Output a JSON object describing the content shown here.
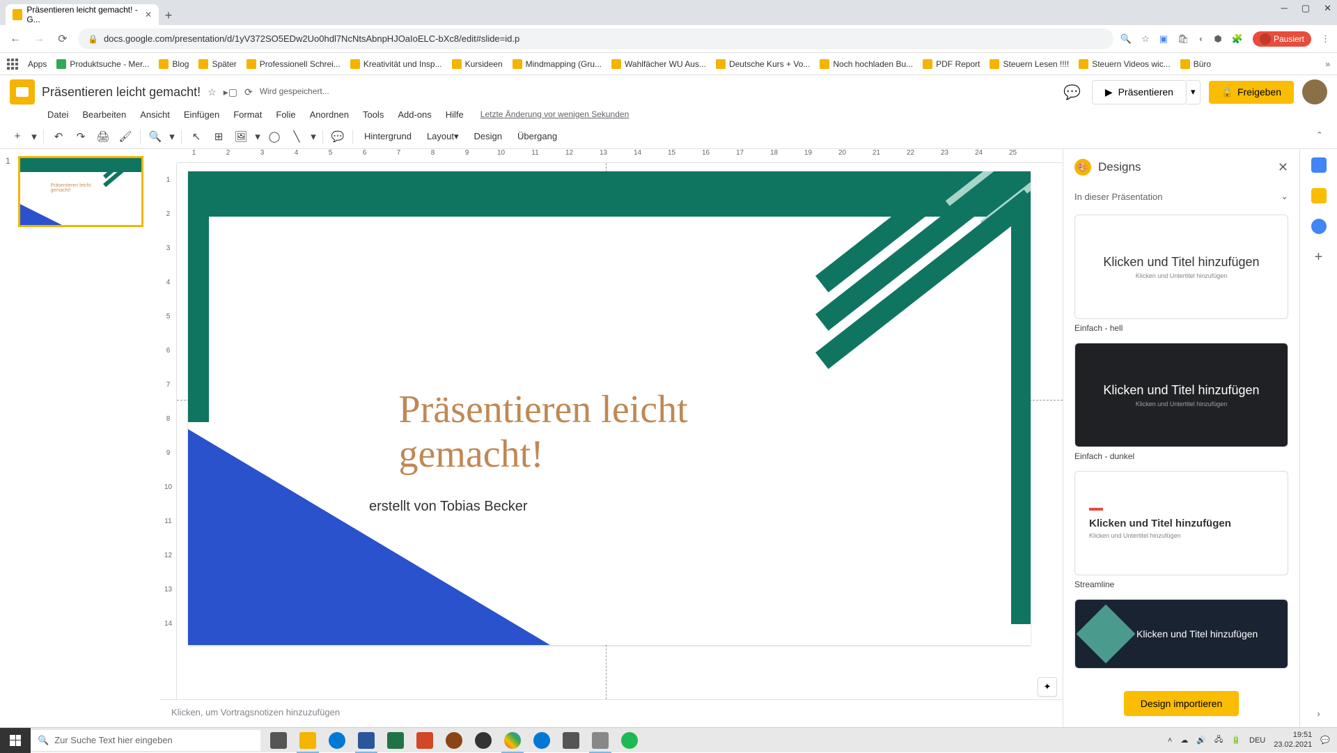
{
  "browser": {
    "tab_title": "Präsentieren leicht gemacht! - G...",
    "url": "docs.google.com/presentation/d/1yV372SO5EDw2Uo0hdl7NcNtsAbnpHJOaIoELC-bXc8/edit#slide=id.p",
    "avatar_label": "Pausiert"
  },
  "bookmarks": [
    "Apps",
    "Produktsuche - Mer...",
    "Blog",
    "Später",
    "Professionell Schrei...",
    "Kreativität und Insp...",
    "Kursideen",
    "Mindmapping (Gru...",
    "Wahlfächer WU Aus...",
    "Deutsche Kurs + Vo...",
    "Noch hochladen Bu...",
    "PDF Report",
    "Steuern Lesen !!!!",
    "Steuern Videos wic...",
    "Büro"
  ],
  "doc": {
    "title": "Präsentieren leicht gemacht!",
    "save_status": "Wird gespeichert...",
    "last_edit": "Letzte Änderung vor wenigen Sekunden"
  },
  "header_buttons": {
    "present": "Präsentieren",
    "share": "Freigeben"
  },
  "menus": [
    "Datei",
    "Bearbeiten",
    "Ansicht",
    "Einfügen",
    "Format",
    "Folie",
    "Anordnen",
    "Tools",
    "Add-ons",
    "Hilfe"
  ],
  "toolbar_text": {
    "background": "Hintergrund",
    "layout": "Layout",
    "design": "Design",
    "transition": "Übergang"
  },
  "ruler_h": [
    "1",
    "2",
    "3",
    "4",
    "5",
    "6",
    "7",
    "8",
    "9",
    "10",
    "11",
    "12",
    "13",
    "14",
    "15",
    "16",
    "17",
    "18",
    "19",
    "20",
    "21",
    "22",
    "23",
    "24",
    "25"
  ],
  "ruler_v": [
    "1",
    "2",
    "3",
    "4",
    "5",
    "6",
    "7",
    "8",
    "9",
    "10",
    "11",
    "12",
    "13",
    "14"
  ],
  "filmstrip": {
    "slide1_num": "1",
    "slide1_text": "Präsentieren leicht gemacht!"
  },
  "slide": {
    "title": "Präsentieren leicht gemacht!",
    "subtitle": "erstellt von Tobias Becker"
  },
  "notes_placeholder": "Klicken, um Vortragsnotizen hinzuzufügen",
  "designs": {
    "panel_title": "Designs",
    "section": "In dieser Präsentation",
    "card_title": "Klicken und Titel hinzufügen",
    "card_sub": "Klicken und Untertitel hinzufügen",
    "label_light": "Einfach - hell",
    "label_dark": "Einfach - dunkel",
    "label_streamline": "Streamline",
    "import": "Design importieren"
  },
  "taskbar": {
    "search_placeholder": "Zur Suche Text hier eingeben",
    "lang": "DEU",
    "time": "19:51",
    "date": "23.02.2021"
  }
}
